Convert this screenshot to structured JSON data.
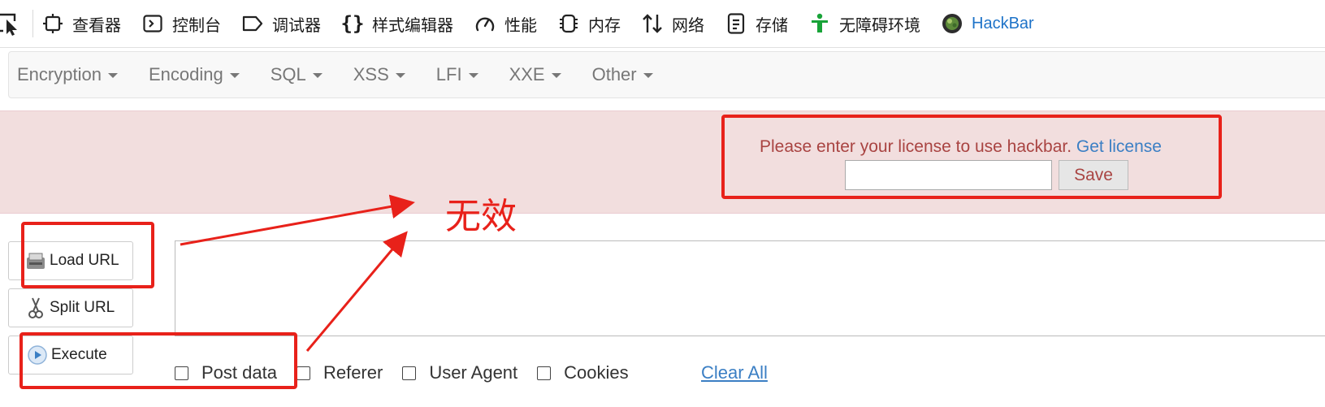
{
  "devtools": {
    "tabs": [
      {
        "label": "查看器",
        "icon": "inspector-icon"
      },
      {
        "label": "控制台",
        "icon": "console-icon"
      },
      {
        "label": "调试器",
        "icon": "debugger-icon"
      },
      {
        "label": "样式编辑器",
        "icon": "style-editor-icon"
      },
      {
        "label": "性能",
        "icon": "performance-icon"
      },
      {
        "label": "内存",
        "icon": "memory-icon"
      },
      {
        "label": "网络",
        "icon": "network-icon"
      },
      {
        "label": "存储",
        "icon": "storage-icon"
      },
      {
        "label": "无障碍环境",
        "icon": "accessibility-icon"
      },
      {
        "label": "HackBar",
        "icon": "hackbar-icon"
      }
    ],
    "active_tab": "HackBar",
    "accent_color": "#1e73c8"
  },
  "menu": {
    "items": [
      "Encryption",
      "Encoding",
      "SQL",
      "XSS",
      "LFI",
      "XXE",
      "Other"
    ]
  },
  "license": {
    "message": "Please enter your license to use hackbar.",
    "link": "Get license",
    "input_value": "",
    "save_label": "Save",
    "bg_color": "#f2dede",
    "text_color": "#a94442"
  },
  "buttons": {
    "load_url": "Load URL",
    "split_url": "Split URL",
    "execute": "Execute"
  },
  "url_value": "",
  "options": [
    {
      "label": "Post data",
      "checked": false
    },
    {
      "label": "Referer",
      "checked": false
    },
    {
      "label": "User Agent",
      "checked": false
    },
    {
      "label": "Cookies",
      "checked": false
    }
  ],
  "clear_all": "Clear All",
  "annotation": {
    "text": "无效",
    "color": "#e8211a"
  }
}
